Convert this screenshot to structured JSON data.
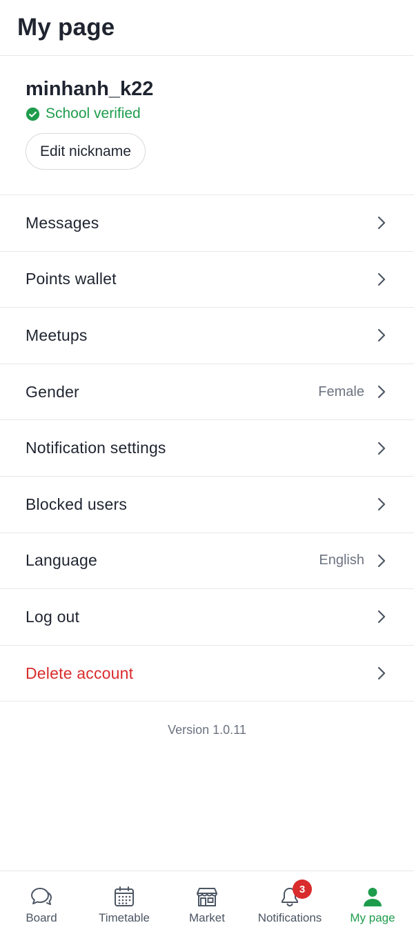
{
  "header": {
    "title": "My page"
  },
  "profile": {
    "nickname": "minhanh_k22",
    "verified_label": "School verified",
    "edit_label": "Edit nickname"
  },
  "menu": {
    "messages": "Messages",
    "points_wallet": "Points wallet",
    "meetups": "Meetups",
    "gender": "Gender",
    "gender_value": "Female",
    "notification_settings": "Notification settings",
    "blocked_users": "Blocked users",
    "language": "Language",
    "language_value": "English",
    "log_out": "Log out",
    "delete_account": "Delete account"
  },
  "version": "Version 1.0.11",
  "tabs": {
    "board": "Board",
    "timetable": "Timetable",
    "market": "Market",
    "notifications": "Notifications",
    "notifications_badge": "3",
    "mypage": "My page"
  },
  "colors": {
    "accent": "#1e9c4c",
    "danger": "#d92c2c",
    "text": "#1f2430",
    "muted": "#6b7280",
    "divider": "#e5e7eb"
  },
  "icons": {
    "board": "chat-bubbles-icon",
    "timetable": "calendar-icon",
    "market": "store-icon",
    "notifications": "bell-icon",
    "mypage": "person-icon",
    "verified": "check-circle-icon",
    "row_arrow": "chevron-right-icon"
  }
}
